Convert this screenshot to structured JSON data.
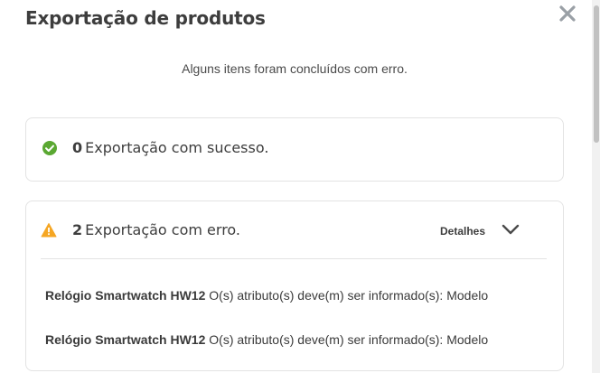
{
  "modal": {
    "title": "Exportação de produtos",
    "subtitle": "Alguns itens foram concluídos com erro."
  },
  "success_card": {
    "count": "0",
    "label": "Exportação com sucesso.",
    "icon": "check-circle-icon",
    "color": "#5aa832"
  },
  "error_card": {
    "count": "2",
    "label": "Exportação com erro.",
    "icon": "warning-triangle-icon",
    "color": "#f5a623",
    "details_label": "Detalhes",
    "items": [
      {
        "product": "Relógio Smartwatch HW12",
        "message": "O(s) atributo(s) deve(m) ser informado(s): Modelo"
      },
      {
        "product": "Relógio Smartwatch HW12",
        "message": "O(s) atributo(s) deve(m) ser informado(s): Modelo"
      }
    ]
  }
}
